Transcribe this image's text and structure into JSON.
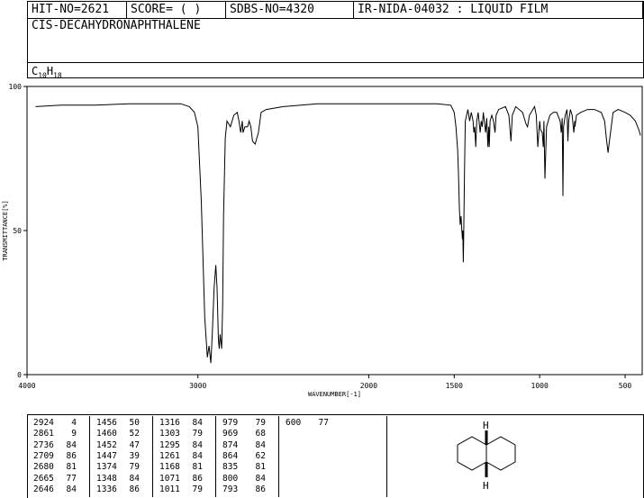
{
  "header": {
    "hit_no": "HIT-NO=2621",
    "score": "SCORE=  (    )",
    "sdbs_no": "SDBS-NO=4320",
    "ir_nida": "IR-NIDA-04032 : LIQUID FILM",
    "compound_name": "CIS-DECAHYDRONAPHTHALENE",
    "formula_c": "C",
    "formula_c_sub": "10",
    "formula_h": "H",
    "formula_h_sub": "18"
  },
  "chart_data": {
    "type": "line",
    "xlabel": "WAVENUMBER[-1]",
    "ylabel": "TRANSMITTANCE[%]",
    "xlim": [
      4000,
      400
    ],
    "ylim": [
      0,
      100
    ],
    "x_ticks": [
      "4000",
      "3000",
      "2000",
      "1500",
      "1000",
      "500"
    ],
    "y_ticks": [
      "100",
      "50",
      "0"
    ],
    "series": [
      {
        "x": [
          3950,
          3800,
          3600,
          3400,
          3200,
          3100,
          3050,
          3020,
          3000,
          2980,
          2960,
          2945,
          2935,
          2924,
          2915,
          2905,
          2895,
          2888,
          2880,
          2875,
          2870,
          2861,
          2855,
          2850,
          2840,
          2830,
          2810,
          2790,
          2770,
          2760,
          2750,
          2740,
          2736,
          2725,
          2709,
          2700,
          2690,
          2680,
          2665,
          2646,
          2630,
          2600,
          2500,
          2300,
          2100,
          1900,
          1800,
          1700,
          1600,
          1520,
          1500,
          1490,
          1480,
          1475,
          1470,
          1465,
          1460,
          1456,
          1455,
          1452,
          1450,
          1447,
          1445,
          1440,
          1435,
          1420,
          1410,
          1400,
          1390,
          1385,
          1380,
          1374,
          1368,
          1360,
          1348,
          1342,
          1336,
          1330,
          1316,
          1310,
          1303,
          1298,
          1295,
          1290,
          1280,
          1270,
          1261,
          1255,
          1240,
          1200,
          1180,
          1168,
          1160,
          1140,
          1100,
          1080,
          1071,
          1060,
          1040,
          1030,
          1020,
          1011,
          1005,
          1000,
          995,
          985,
          979,
          975,
          969,
          960,
          940,
          920,
          900,
          880,
          874,
          868,
          864,
          860,
          850,
          840,
          835,
          830,
          820,
          810,
          800,
          795,
          793,
          785,
          760,
          720,
          680,
          640,
          620,
          610,
          600,
          590,
          570,
          540,
          500,
          470,
          440,
          420,
          410
        ],
        "y": [
          93,
          93.5,
          93.5,
          94,
          94,
          94,
          93,
          91,
          86,
          60,
          20,
          6,
          10,
          4,
          15,
          30,
          38,
          30,
          12,
          9,
          14,
          9,
          24,
          55,
          82,
          88,
          86,
          90,
          91,
          88,
          84,
          88,
          84,
          86,
          86,
          88,
          86,
          81,
          80,
          84,
          91,
          92,
          93,
          94,
          94,
          94,
          94,
          94,
          94,
          93.5,
          91,
          86,
          78,
          70,
          58,
          52,
          55,
          50,
          50,
          47,
          50,
          39,
          45,
          70,
          88,
          92,
          88,
          91,
          88,
          84,
          86,
          79,
          88,
          91,
          84,
          88,
          86,
          91,
          84,
          89,
          79,
          86,
          79,
          88,
          90,
          88,
          84,
          90,
          92,
          93,
          90,
          81,
          90,
          93,
          91,
          87,
          86,
          90,
          92,
          93,
          90,
          79,
          84,
          88,
          85,
          84,
          79,
          88,
          68,
          86,
          90,
          91,
          91,
          88,
          84,
          89,
          62,
          86,
          90,
          92,
          81,
          88,
          92,
          90,
          84,
          88,
          86,
          90,
          91,
          92,
          92,
          91,
          88,
          82,
          77,
          82,
          91,
          92,
          91,
          90,
          88,
          85,
          83
        ]
      }
    ]
  },
  "peaks": [
    [
      [
        "2924",
        "4"
      ],
      [
        "2861",
        "9"
      ],
      [
        "2736",
        "84"
      ],
      [
        "2709",
        "86"
      ],
      [
        "2680",
        "81"
      ],
      [
        "2665",
        "77"
      ],
      [
        "2646",
        "84"
      ]
    ],
    [
      [
        "1456",
        "50"
      ],
      [
        "1460",
        "52"
      ],
      [
        "1452",
        "47"
      ],
      [
        "1447",
        "39"
      ],
      [
        "1374",
        "79"
      ],
      [
        "1348",
        "84"
      ],
      [
        "1336",
        "86"
      ]
    ],
    [
      [
        "1316",
        "84"
      ],
      [
        "1303",
        "79"
      ],
      [
        "1295",
        "84"
      ],
      [
        "1261",
        "84"
      ],
      [
        "1168",
        "81"
      ],
      [
        "1071",
        "86"
      ],
      [
        "1011",
        "79"
      ]
    ],
    [
      [
        "979",
        "79"
      ],
      [
        "969",
        "68"
      ],
      [
        "874",
        "84"
      ],
      [
        "864",
        "62"
      ],
      [
        "835",
        "81"
      ],
      [
        "800",
        "84"
      ],
      [
        "793",
        "86"
      ]
    ],
    [
      [
        "600",
        "77"
      ]
    ]
  ],
  "structure": {
    "atom_top": "H",
    "atom_bottom": "H"
  }
}
